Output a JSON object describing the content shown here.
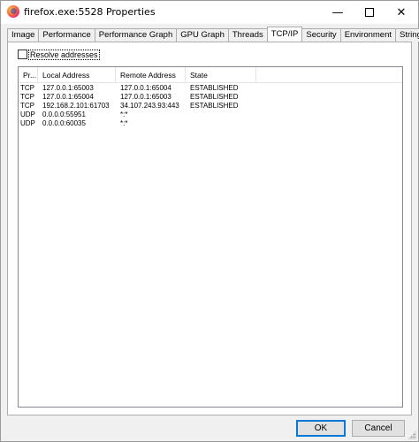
{
  "window": {
    "title": "firefox.exe:5528 Properties",
    "minimize": "—",
    "close": "✕"
  },
  "tabs": [
    {
      "label": "Image"
    },
    {
      "label": "Performance"
    },
    {
      "label": "Performance Graph"
    },
    {
      "label": "GPU Graph"
    },
    {
      "label": "Threads"
    },
    {
      "label": "TCP/IP",
      "active": true
    },
    {
      "label": "Security"
    },
    {
      "label": "Environment"
    },
    {
      "label": "Strings"
    }
  ],
  "options": {
    "resolve_addresses_label": "Resolve addresses",
    "resolve_addresses_checked": false
  },
  "table": {
    "columns": [
      "Pr...",
      "Local Address",
      "Remote Address",
      "State"
    ],
    "rows": [
      [
        "TCP",
        "127.0.0.1:65003",
        "127.0.0.1:65004",
        "ESTABLISHED"
      ],
      [
        "TCP",
        "127.0.0.1:65004",
        "127.0.0.1:65003",
        "ESTABLISHED"
      ],
      [
        "TCP",
        "192.168.2.101:61703",
        "34.107.243.93:443",
        "ESTABLISHED"
      ],
      [
        "UDP",
        "0.0.0.0:55951",
        "*:*",
        ""
      ],
      [
        "UDP",
        "0.0.0.0:60035",
        "*:*",
        ""
      ]
    ]
  },
  "buttons": {
    "ok": "OK",
    "cancel": "Cancel"
  },
  "colors": {
    "accent": "#0078d7"
  }
}
